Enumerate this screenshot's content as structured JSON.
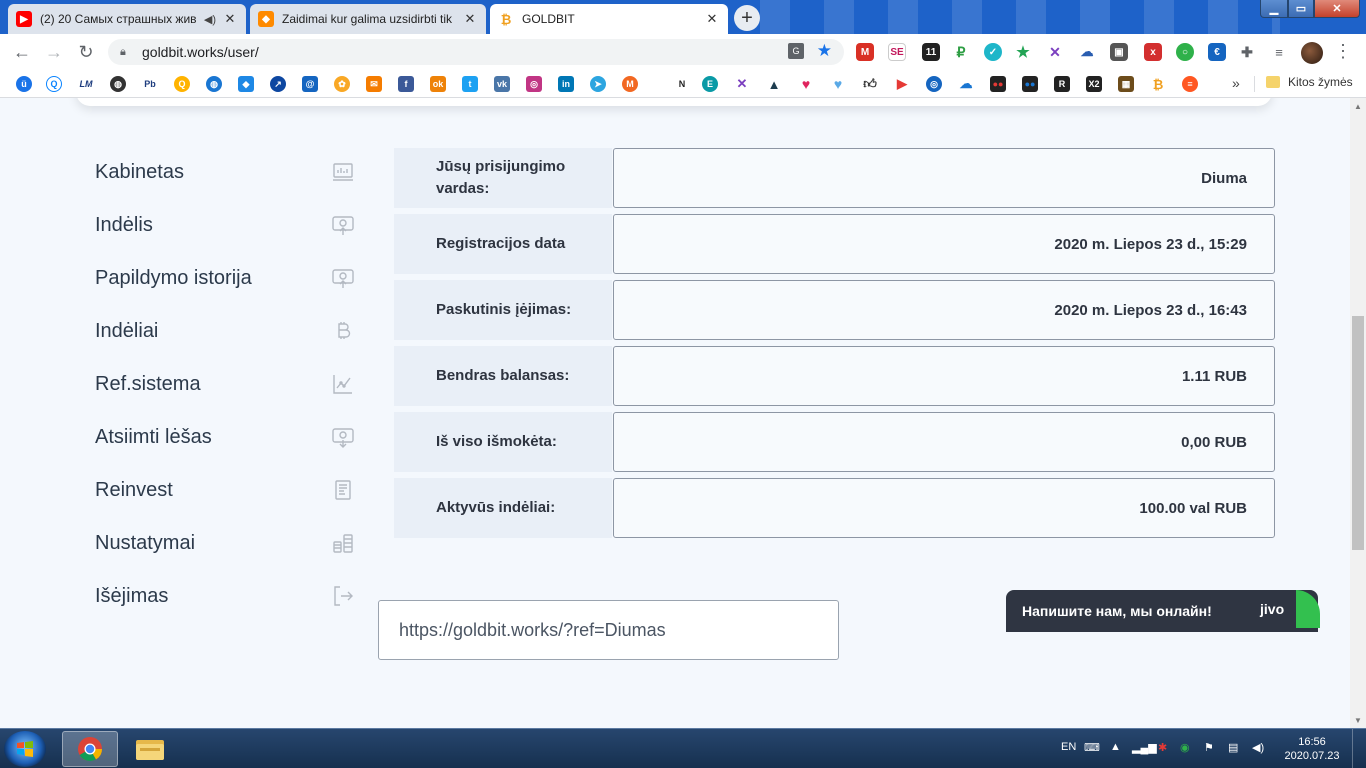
{
  "browser": {
    "tabs": [
      {
        "title": "(2) 20 Самых страшных жив",
        "icon": "youtube-icon"
      },
      {
        "title": "Zaidimai kur galima uzsidirbti tik",
        "icon": "game-icon"
      },
      {
        "title": "GOLDBIT",
        "icon": "bitcoin-icon"
      }
    ],
    "url": "goldbit.works/user/",
    "bookmarks_overflow": "»",
    "other_bookmarks": "Kitos žymės"
  },
  "sidebar": {
    "items": [
      {
        "label": "Kabinetas",
        "icon": "dashboard-icon"
      },
      {
        "label": "Indėlis",
        "icon": "deposit-upload-icon"
      },
      {
        "label": "Papildymo istorija",
        "icon": "deposit-history-icon"
      },
      {
        "label": "Indėliai",
        "icon": "bitcoin-icon"
      },
      {
        "label": "Ref.sistema",
        "icon": "chart-growth-icon"
      },
      {
        "label": "Atsiimti lėšas",
        "icon": "withdraw-icon"
      },
      {
        "label": "Reinvest",
        "icon": "document-icon"
      },
      {
        "label": "Nustatymai",
        "icon": "coins-icon"
      },
      {
        "label": "Išėjimas",
        "icon": "logout-icon"
      }
    ]
  },
  "account": {
    "rows": [
      {
        "label": "Jūsų prisijungimo vardas:",
        "value": "Diuma"
      },
      {
        "label": "Registracijos data",
        "value": "2020 m. Liepos 23 d., 15:29"
      },
      {
        "label": "Paskutinis įėjimas:",
        "value": "2020 m. Liepos 23 d., 16:43"
      },
      {
        "label": "Bendras balansas:",
        "value": "1.11 RUB"
      },
      {
        "label": "Iš viso išmokėta:",
        "value": "0,00 RUB"
      },
      {
        "label": "Aktyvūs indėliai:",
        "value": "100.00 val RUB"
      }
    ],
    "ref_link": "https://goldbit.works/?ref=Diumas"
  },
  "chat": {
    "text": "Напишите нам, мы онлайн!",
    "brand": "jivo"
  },
  "taskbar": {
    "language": "EN",
    "time": "16:56",
    "date": "2020.07.23"
  },
  "colors": {
    "page_bg": "#f4f8fd",
    "label_bg": "#e9eff7",
    "text_dark": "#2e3440",
    "chat_bg": "#2f3542",
    "chat_accent": "#33c04f"
  }
}
